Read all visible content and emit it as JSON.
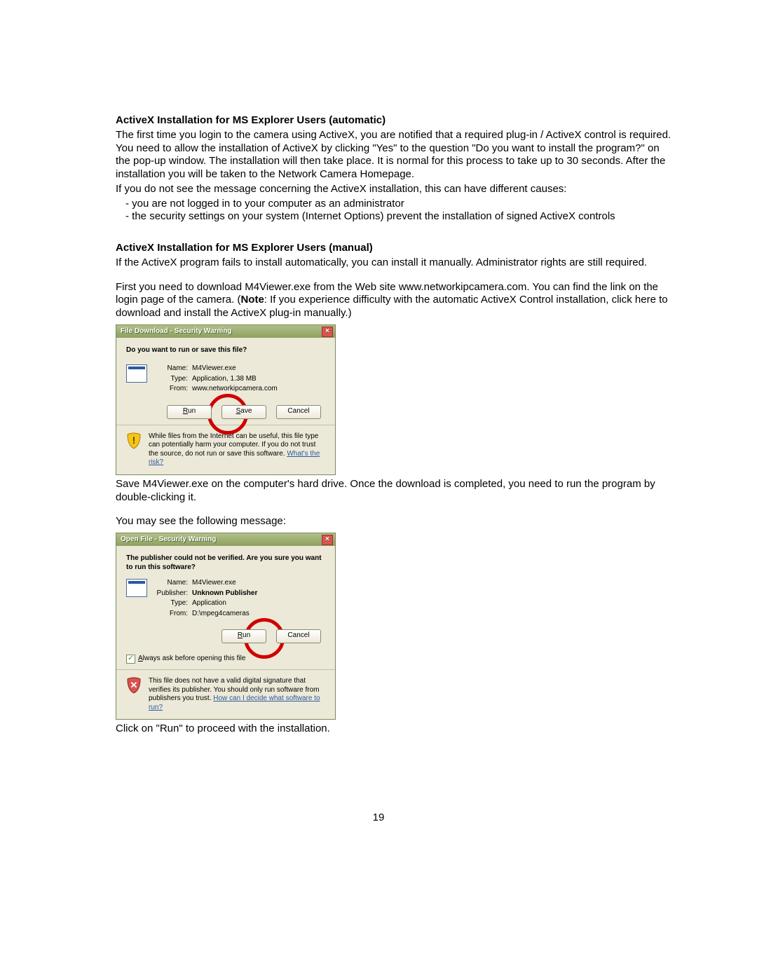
{
  "section1": {
    "heading": "ActiveX Installation for MS Explorer Users (automatic)",
    "p1": "The first time you login to the camera using ActiveX, you are notified that a required plug-in / ActiveX control is required. You need to allow the installation of ActiveX by clicking \"Yes\" to the question \"Do you want to install the program?\" on the pop-up window. The installation will then take place. It is normal for this process to take up to 30 seconds. After the installation you will be taken to the Network Camera Homepage.",
    "p2": "If you do not see the message concerning the ActiveX installation, this can have different causes:",
    "bullets": [
      "you are not logged in to your computer as an administrator",
      "the security settings on your system (Internet Options) prevent the installation of signed ActiveX controls"
    ]
  },
  "section2": {
    "heading": "ActiveX Installation for MS Explorer Users (manual)",
    "p1": "If the ActiveX program fails to install automatically, you can install it manually. Administrator rights are still required.",
    "p2a": "First you need to download M4Viewer.exe from the Web site www.networkipcamera.com. You can find the link on the login page of the camera. (",
    "note_label": "Note",
    "p2b": ": If you experience difficulty with the automatic ActiveX Control installation, click here to download and install the ActiveX plug-in manually.)"
  },
  "dialog1": {
    "title": "File Download - Security Warning",
    "question": "Do you want to run or save this file?",
    "name_label": "Name:",
    "name_value": "M4Viewer.exe",
    "type_label": "Type:",
    "type_value": "Application, 1.38 MB",
    "from_label": "From:",
    "from_value": "www.networkipcamera.com",
    "run_u": "R",
    "run_rest": "un",
    "save_u": "S",
    "save_rest": "ave",
    "cancel": "Cancel",
    "warn": "While files from the Internet can be useful, this file type can potentially harm your computer. If you do not trust the source, do not run or save this software. ",
    "warn_link": "What's the risk?"
  },
  "after1": "Save M4Viewer.exe on the computer's hard drive. Once the download is completed, you need to run the program by double-clicking it.",
  "before2": "You may see the following message:",
  "dialog2": {
    "title": "Open File - Security Warning",
    "question": "The publisher could not be verified.  Are you sure you want to run this software?",
    "name_label": "Name:",
    "name_value": "M4Viewer.exe",
    "pub_label": "Publisher:",
    "pub_value": "Unknown Publisher",
    "type_label": "Type:",
    "type_value": "Application",
    "from_label": "From:",
    "from_value": "D:\\mpeg4cameras",
    "run_u": "R",
    "run_rest": "un",
    "cancel": "Cancel",
    "checkbox_u": "A",
    "checkbox_rest": "lways ask before opening this file",
    "warn": "This file does not have a valid digital signature that verifies its publisher. You should only run software from publishers you trust. ",
    "warn_link": "How can I decide what software to run?"
  },
  "after2": "Click on \"Run\" to proceed with the installation.",
  "page_number": "19"
}
